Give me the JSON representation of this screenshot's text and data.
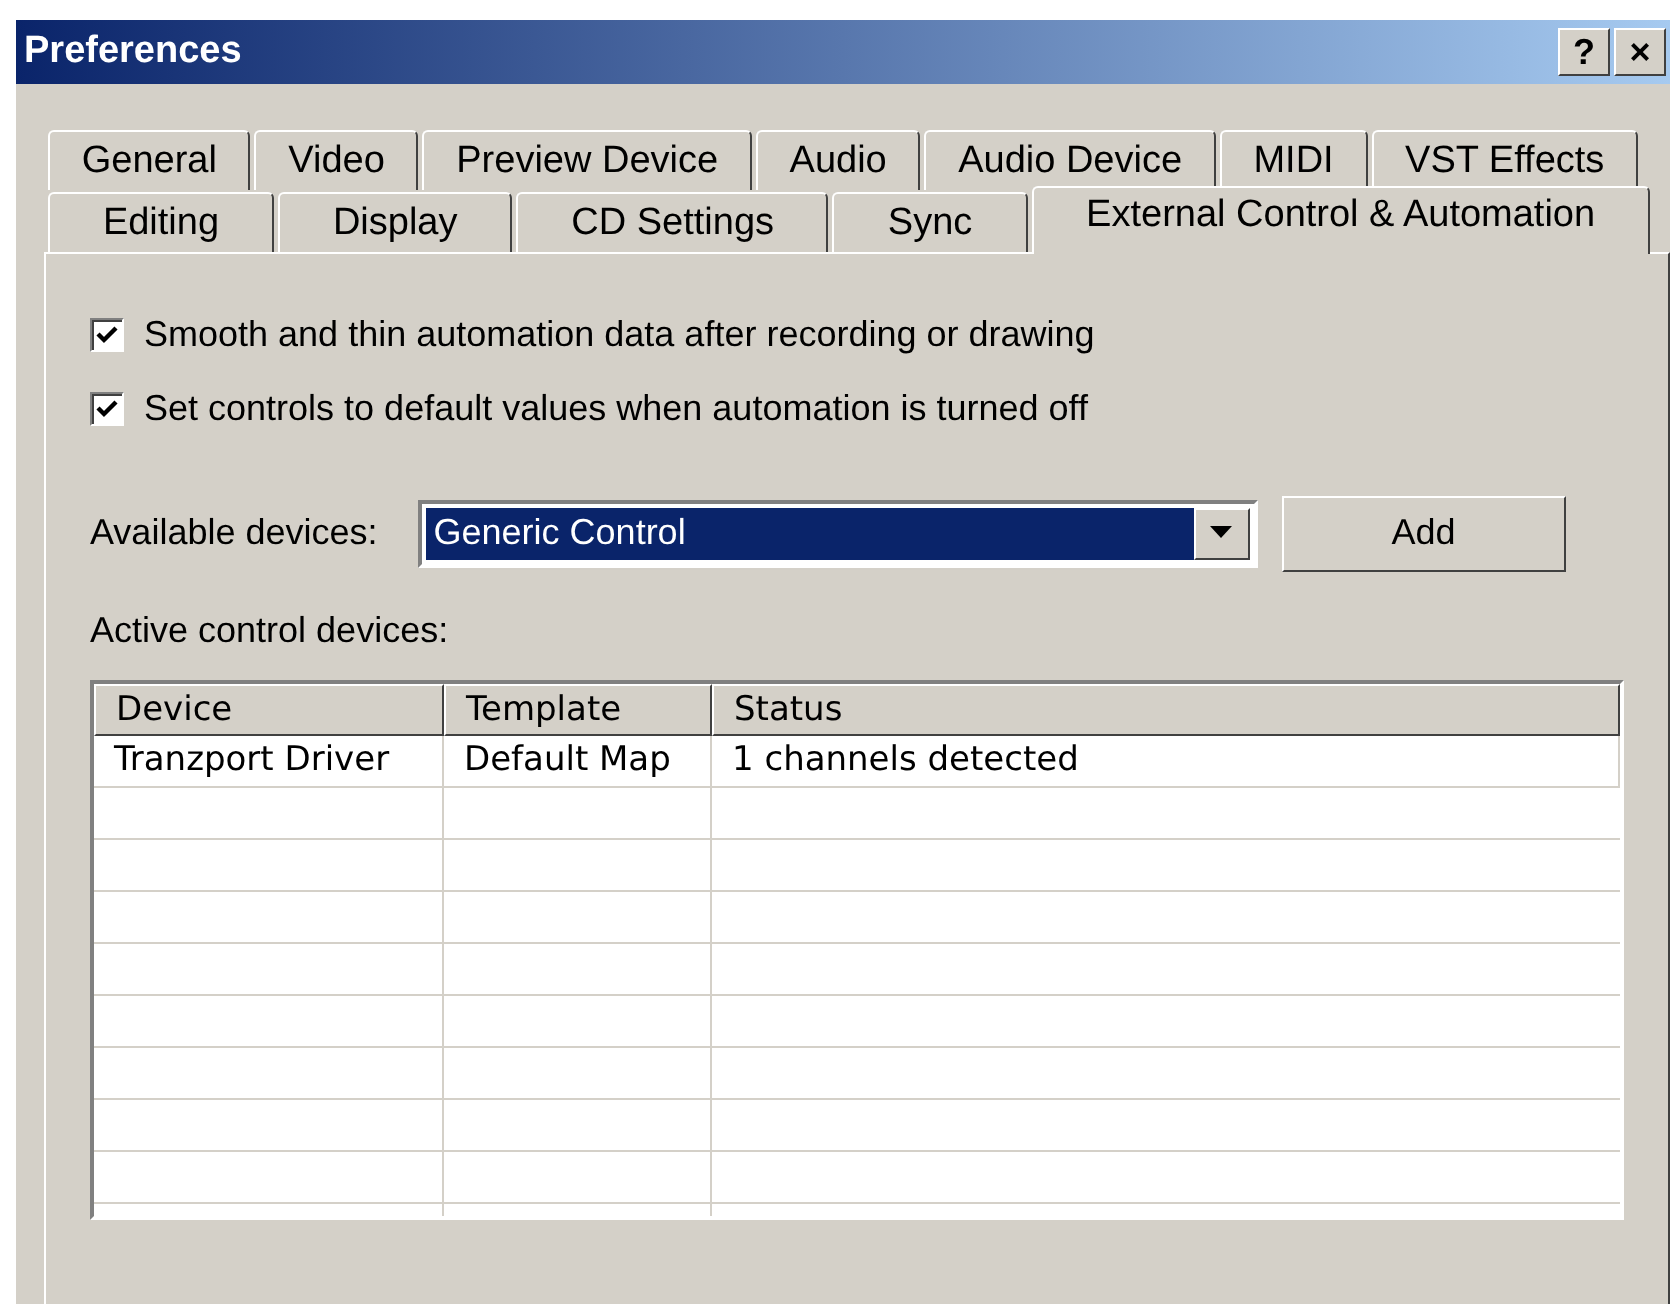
{
  "window": {
    "title": "Preferences",
    "buttons": [
      "?",
      "×"
    ]
  },
  "tab_rows": [
    [
      {
        "label": "General",
        "selected": false
      },
      {
        "label": "Video",
        "selected": false
      },
      {
        "label": "Preview Device",
        "selected": false
      },
      {
        "label": "Audio",
        "selected": false
      },
      {
        "label": "Audio Device",
        "selected": false
      },
      {
        "label": "MIDI",
        "selected": false
      },
      {
        "label": "VST Effects",
        "selected": false
      }
    ],
    [
      {
        "label": "Editing",
        "selected": false
      },
      {
        "label": "Display",
        "selected": false
      },
      {
        "label": "CD Settings",
        "selected": false
      },
      {
        "label": "Sync",
        "selected": false
      },
      {
        "label": "External Control & Automation",
        "selected": true
      }
    ]
  ],
  "options": [
    {
      "label": "Smooth and thin automation data after recording or drawing",
      "checked": true
    },
    {
      "label": "Set controls to default values when automation is turned off",
      "checked": true
    }
  ],
  "available_devices": {
    "label": "Available devices:",
    "value": "Generic Control",
    "button": "Add"
  },
  "active_devices": {
    "label": "Active control devices:",
    "columns": [
      "Device",
      "Template",
      "Status"
    ],
    "rows": [
      {
        "cells": [
          "Tranzport Driver",
          "Default Map",
          "1 channels detected"
        ]
      }
    ]
  }
}
